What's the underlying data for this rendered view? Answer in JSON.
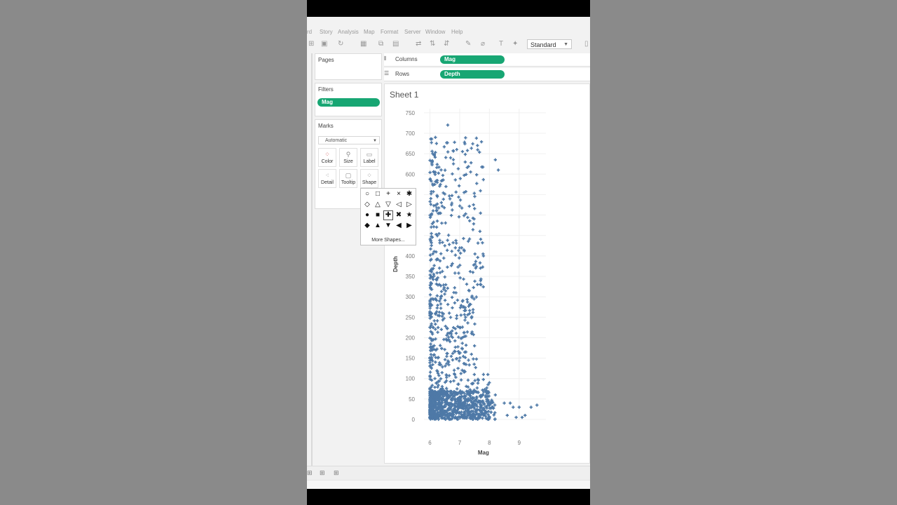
{
  "menu": [
    "rd",
    "Story",
    "Analysis",
    "Map",
    "Format",
    "Server",
    "Window",
    "Help"
  ],
  "toolbar": {
    "fit_select": "Standard"
  },
  "pages_card": {
    "title": "Pages"
  },
  "filters_card": {
    "title": "Filters",
    "pill": "Mag"
  },
  "marks_card": {
    "title": "Marks",
    "mark_type": "Automatic",
    "buttons": [
      "Color",
      "Size",
      "Label",
      "Detail",
      "Tooltip",
      "Shape"
    ]
  },
  "shelves": {
    "columns_label": "Columns",
    "columns_pill": "Mag",
    "rows_label": "Rows",
    "rows_pill": "Depth"
  },
  "shape_palette": {
    "shapes": [
      "circle",
      "square",
      "plus",
      "cross",
      "asterisk",
      "diamond",
      "triangle-up",
      "triangle-down",
      "triangle-left",
      "triangle-right",
      "filled-circle",
      "filled-square",
      "filled-plus",
      "filled-cross",
      "filled-star",
      "filled-diamond",
      "filled-triangle-up",
      "filled-triangle-down",
      "filled-triangle-left",
      "filled-triangle-right"
    ],
    "selected": "filled-plus",
    "more_label": "More Shapes..."
  },
  "sheet": {
    "title": "Sheet 1"
  },
  "colors": {
    "pill": "#17a673",
    "marks": "#4e79a7"
  },
  "chart_data": {
    "type": "scatter",
    "xlabel": "Mag",
    "ylabel": "Depth",
    "xlim": [
      5.8,
      9.9
    ],
    "ylim": [
      0,
      760
    ],
    "xticks": [
      "6",
      "7",
      "8",
      "9"
    ],
    "yticks": [
      "0",
      "50",
      "100",
      "150",
      "200",
      "250",
      "300",
      "350",
      "400",
      "450",
      "500",
      "550",
      "600",
      "650",
      "700",
      "750"
    ],
    "grid": true,
    "mark_shape": "filled-plus",
    "points": [
      [
        6.6,
        720
      ],
      [
        7.6,
        670
      ],
      [
        8.2,
        635
      ],
      [
        8.3,
        610
      ],
      [
        7.8,
        400
      ],
      [
        7.7,
        370
      ],
      [
        7.6,
        330
      ],
      [
        7.2,
        250
      ],
      [
        7.4,
        210
      ],
      [
        7.5,
        180
      ],
      [
        7.8,
        110
      ],
      [
        8.0,
        90
      ],
      [
        8.2,
        60
      ],
      [
        8.5,
        40
      ],
      [
        8.7,
        40
      ],
      [
        8.8,
        30
      ],
      [
        8.6,
        10
      ],
      [
        9.2,
        10
      ],
      [
        9.4,
        30
      ],
      [
        9.6,
        35
      ],
      [
        9.0,
        30
      ],
      [
        8.9,
        5
      ],
      [
        9.1,
        5
      ]
    ]
  }
}
